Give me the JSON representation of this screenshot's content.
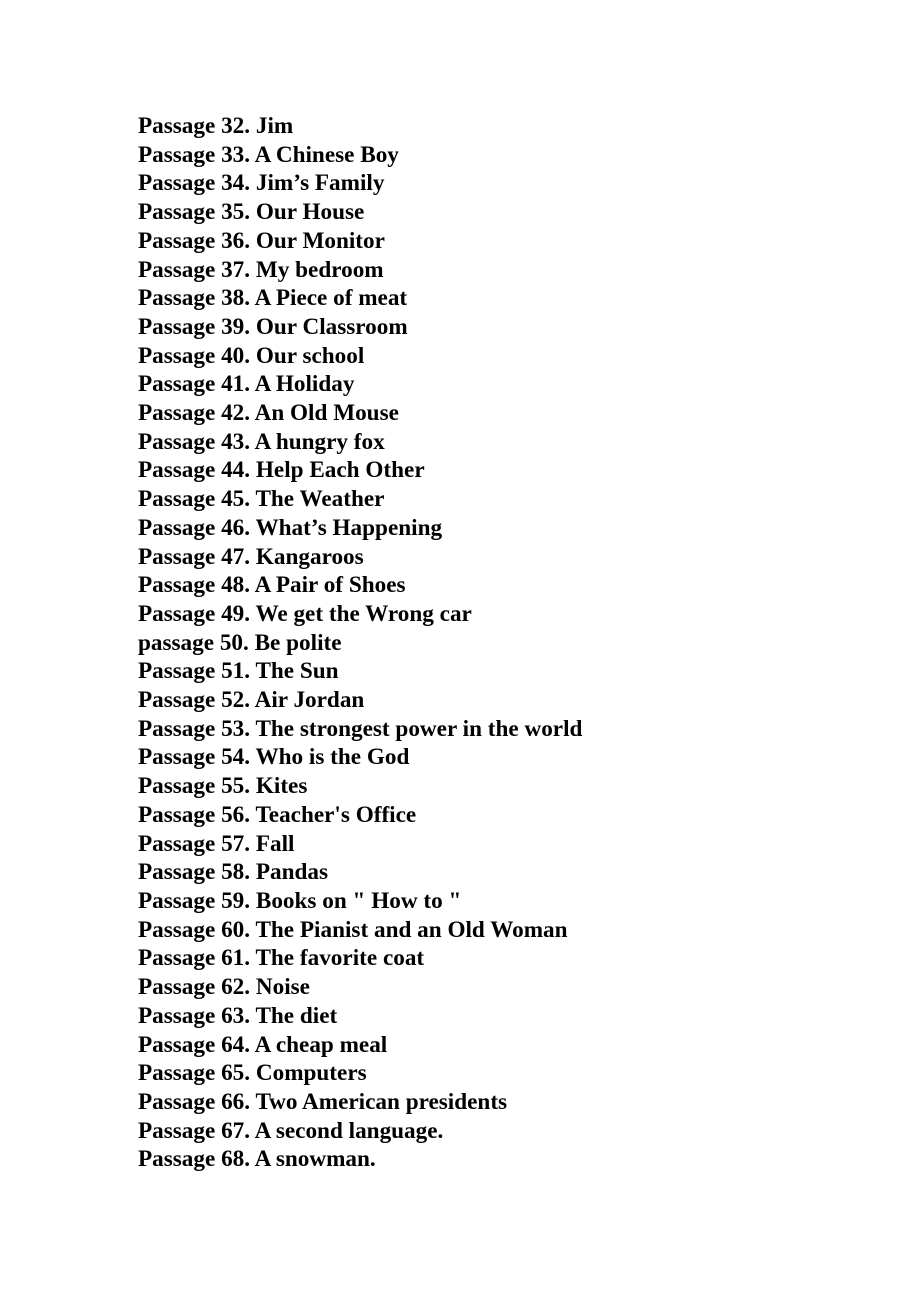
{
  "document": {
    "type": "table-of-contents",
    "page_background": "#ffffff",
    "text_color": "#000000",
    "lines": [
      "Passage 32. Jim",
      "Passage 33. A Chinese Boy",
      "Passage 34. Jim’s Family",
      "Passage 35. Our House",
      "Passage 36. Our Monitor",
      "Passage 37. My bedroom",
      "Passage 38. A Piece of meat",
      "Passage 39. Our Classroom",
      "Passage 40. Our school",
      "Passage 41. A Holiday",
      "Passage 42. An Old Mouse",
      "Passage 43. A hungry fox",
      "Passage 44. Help Each Other",
      "Passage 45. The Weather",
      "Passage 46. What’s Happening",
      "Passage 47. Kangaroos",
      "Passage 48. A Pair of Shoes",
      "Passage 49. We get the Wrong car",
      "passage 50. Be polite",
      "Passage 51. The Sun",
      "Passage 52. Air Jordan",
      "Passage 53. The strongest power in the world",
      "Passage 54. Who is the God",
      "Passage 55. Kites",
      "Passage 56. Teacher's Office",
      "Passage 57. Fall",
      "Passage 58. Pandas",
      "Passage 59. Books on \" How to \"",
      "Passage 60. The Pianist and an Old Woman",
      "Passage 61. The favorite coat",
      "Passage 62. Noise",
      "Passage 63. The diet",
      "Passage 64. A cheap meal",
      "Passage 65. Computers",
      "Passage 66. Two American presidents",
      "Passage 67. A second language.",
      "Passage 68. A snowman."
    ]
  }
}
